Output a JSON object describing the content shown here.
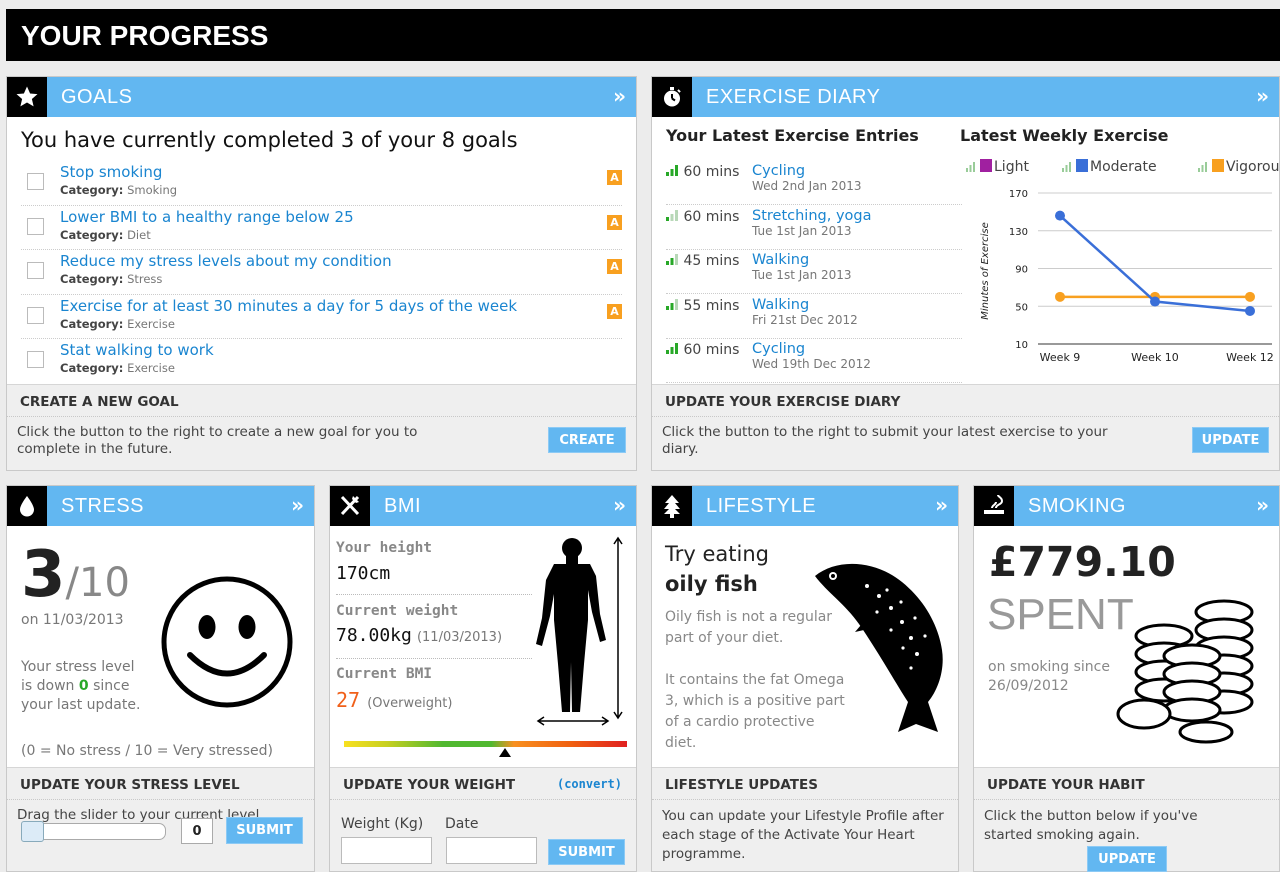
{
  "page_title": "YOUR PROGRESS",
  "goals": {
    "title": "GOALS",
    "summary": "You have currently completed 3 of your 8 goals",
    "category_label": "Category:",
    "items": [
      {
        "title": "Stop smoking",
        "category": "Smoking",
        "badge": "A"
      },
      {
        "title": "Lower BMI to a healthy range below 25",
        "category": "Diet",
        "badge": "A"
      },
      {
        "title": "Reduce my stress levels about my condition",
        "category": "Stress",
        "badge": "A"
      },
      {
        "title": "Exercise for at least 30 minutes a day for 5 days of the week",
        "category": "Exercise",
        "badge": "A"
      },
      {
        "title": "Stat walking to work",
        "category": "Exercise",
        "badge": ""
      }
    ],
    "footer_heading": "CREATE A NEW GOAL",
    "footer_text": "Click the button to the right to create a new goal for you to complete in the future.",
    "button": "CREATE"
  },
  "exercise": {
    "title": "EXERCISE DIARY",
    "entries_heading": "Your Latest Exercise Entries",
    "chart_heading": "Latest Weekly Exercise",
    "entries": [
      {
        "mins": "60 mins",
        "activity": "Cycling",
        "date": "Wed 2nd Jan 2013",
        "intensity": "vigorous"
      },
      {
        "mins": "60 mins",
        "activity": "Stretching, yoga",
        "date": "Tue 1st Jan 2013",
        "intensity": "light"
      },
      {
        "mins": "45 mins",
        "activity": "Walking",
        "date": "Tue 1st Jan 2013",
        "intensity": "moderate"
      },
      {
        "mins": "55 mins",
        "activity": "Walking",
        "date": "Fri 21st Dec 2012",
        "intensity": "moderate"
      },
      {
        "mins": "60 mins",
        "activity": "Cycling",
        "date": "Wed 19th Dec 2012",
        "intensity": "vigorous"
      }
    ],
    "footer_heading": "UPDATE YOUR EXERCISE DIARY",
    "footer_text": "Click the button to the right to submit your latest exercise to your diary.",
    "button": "UPDATE"
  },
  "chart_data": {
    "type": "line",
    "title": "Latest Weekly Exercise",
    "xlabel": "",
    "ylabel": "Minutes of Exercise",
    "categories": [
      "Week 9",
      "Week 10",
      "Week 12"
    ],
    "yticks": [
      10,
      50,
      90,
      130,
      170
    ],
    "ylim": [
      10,
      170
    ],
    "grid": true,
    "legend_position": "top",
    "series": [
      {
        "name": "Light",
        "color": "#a020a0",
        "values": [
          null,
          null,
          null
        ]
      },
      {
        "name": "Moderate",
        "color": "#3a6fd8",
        "values": [
          146,
          55,
          45
        ]
      },
      {
        "name": "Vigorous",
        "color": "#f8a020",
        "values": [
          60,
          60,
          60
        ]
      }
    ]
  },
  "stress": {
    "title": "STRESS",
    "score": "3",
    "out_of": "/10",
    "date": "on 11/03/2013",
    "msg_a": "Your stress level is down",
    "msg_num": "0",
    "msg_b": "since your last update.",
    "scale": "(0 = No stress / 10 = Very stressed)",
    "footer_heading": "UPDATE YOUR STRESS LEVEL",
    "footer_text": "Drag the slider to your current level",
    "slider_value": "0",
    "button": "SUBMIT"
  },
  "bmi": {
    "title": "BMI",
    "height_label": "Your height",
    "height_value": "170cm",
    "weight_label": "Current weight",
    "weight_value": "78.00kg",
    "weight_date": "(11/03/2013)",
    "bmi_label": "Current BMI",
    "bmi_value": "27",
    "bmi_status": "(Overweight)",
    "footer_heading": "UPDATE YOUR WEIGHT",
    "convert_link": "(convert)",
    "weight_field_label": "Weight (Kg)",
    "date_field_label": "Date",
    "button": "SUBMIT"
  },
  "lifestyle": {
    "title": "LIFESTYLE",
    "tip_a": "Try eating",
    "tip_b": "oily fish",
    "text1": "Oily fish is not a regular part of your diet.",
    "text2": "It contains the fat Omega 3, which is a positive part of a cardio protective diet.",
    "footer_heading": "LIFESTYLE UPDATES",
    "footer_text": "You can update your Lifestyle Profile after each stage of the Activate Your Heart programme."
  },
  "smoking": {
    "title": "SMOKING",
    "amount": "£779.10",
    "spent": "SPENT",
    "since": "on smoking since 26/09/2012",
    "footer_heading": "UPDATE YOUR HABIT",
    "footer_text": "Click the button below if you've started smoking again.",
    "button": "UPDATE"
  },
  "colors": {
    "accent": "#62b7f1",
    "link": "#1a85d0",
    "badge": "#f8a020",
    "positive": "#28a828",
    "warning": "#f0601a"
  }
}
